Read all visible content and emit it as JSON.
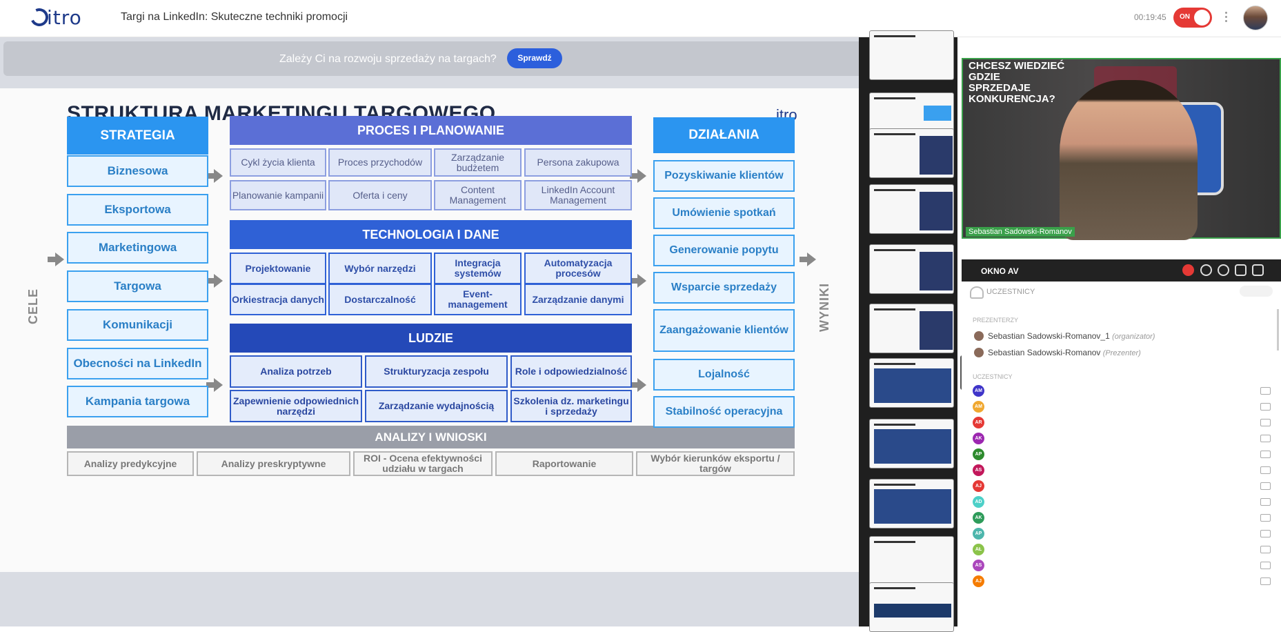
{
  "app": {
    "logo_text": "itro",
    "title": "Targi na LinkedIn: Skuteczne techniki promocji",
    "timer": "00:19:45",
    "toggle_label": "ON"
  },
  "banner": {
    "message": "Zależy Ci na rozwoju sprzedaży na targach?",
    "button": "Sprawdź",
    "close": "✕"
  },
  "slide": {
    "title": "STRUKTURA MARKETINGU TARGOWEGO",
    "logo": "itro",
    "side_left": "CELE",
    "side_right": "WYNIKI",
    "strategia": {
      "header": "STRATEGIA",
      "items": [
        "Biznesowa",
        "Eksportowa",
        "Marketingowa",
        "Targowa",
        "Komunikacji",
        "Obecności na LinkedIn",
        "Kampania targowa"
      ]
    },
    "proces": {
      "header": "PROCES I PLANOWANIE",
      "cells": [
        "Cykl życia klienta",
        "Proces przychodów",
        "Zarządzanie budżetem",
        "Persona zakupowa",
        "Planowanie kampanii",
        "Oferta i ceny",
        "Content Management",
        "LinkedIn Account Management"
      ]
    },
    "technologia": {
      "header": "TECHNOLOGIA I DANE",
      "cells": [
        "Projektowanie",
        "Wybór narzędzi",
        "Integracja systemów",
        "Automatyzacja procesów",
        "Orkiestracja danych",
        "Dostarczalność",
        "Event-management",
        "Zarządzanie danymi"
      ]
    },
    "ludzie": {
      "header": "LUDZIE",
      "cells": [
        "Analiza potrzeb",
        "Strukturyzacja zespołu",
        "Role i odpowiedzialność",
        "Zapewnienie odpowiednich narzędzi",
        "Zarządzanie wydajnością",
        "Szkolenia dz. marketingu i sprzedaży"
      ]
    },
    "dzialania": {
      "header": "DZIAŁANIA",
      "items": [
        "Pozyskiwanie klientów",
        "Umówienie spotkań",
        "Generowanie popytu",
        "Wsparcie sprzedaży",
        "Zaangażowanie klientów",
        "Lojalność",
        "Stabilność operacyjna"
      ]
    },
    "analizy": {
      "header": "ANALIZY I WNIOSKI",
      "cells": [
        "Analizy predykcyjne",
        "Analizy preskryptywne",
        "ROI - Ocena efektywności udziału w targach",
        "Raportowanie",
        "Wybór kierunków eksportu / targów"
      ]
    }
  },
  "video": {
    "overlay_text": "CHCESZ WIEDZIEĆ GDZIE SPRZEDAJE KONKURENCJA?",
    "presenter_name": "Sebastian Sadowski-Romanov",
    "av_label": "OKNO AV"
  },
  "participants": {
    "header": "UCZESTNICY",
    "presenters_label": "PREZENTERZY",
    "participants_label": "UCZESTNICY",
    "presenters": [
      {
        "name": "Sebastian Sadowski-Romanov_1",
        "role": "(organizator)"
      },
      {
        "name": "Sebastian Sadowski-Romanov",
        "role": "(Prezenter)"
      }
    ],
    "list": [
      {
        "initials": "AM",
        "color": "#3f35c9"
      },
      {
        "initials": "AM",
        "color": "#f0a830"
      },
      {
        "initials": "AR",
        "color": "#e53935"
      },
      {
        "initials": "AK",
        "color": "#9c27b0"
      },
      {
        "initials": "AP",
        "color": "#2e8b2e"
      },
      {
        "initials": "AS",
        "color": "#c2185b"
      },
      {
        "initials": "AJ",
        "color": "#e53935"
      },
      {
        "initials": "AD",
        "color": "#4dd0c8"
      },
      {
        "initials": "AK",
        "color": "#2e9b5a"
      },
      {
        "initials": "AP",
        "color": "#4db6ac"
      },
      {
        "initials": "AŁ",
        "color": "#8bc34a"
      },
      {
        "initials": "AS",
        "color": "#ab47bc"
      },
      {
        "initials": "AJ",
        "color": "#f57c00"
      }
    ]
  }
}
